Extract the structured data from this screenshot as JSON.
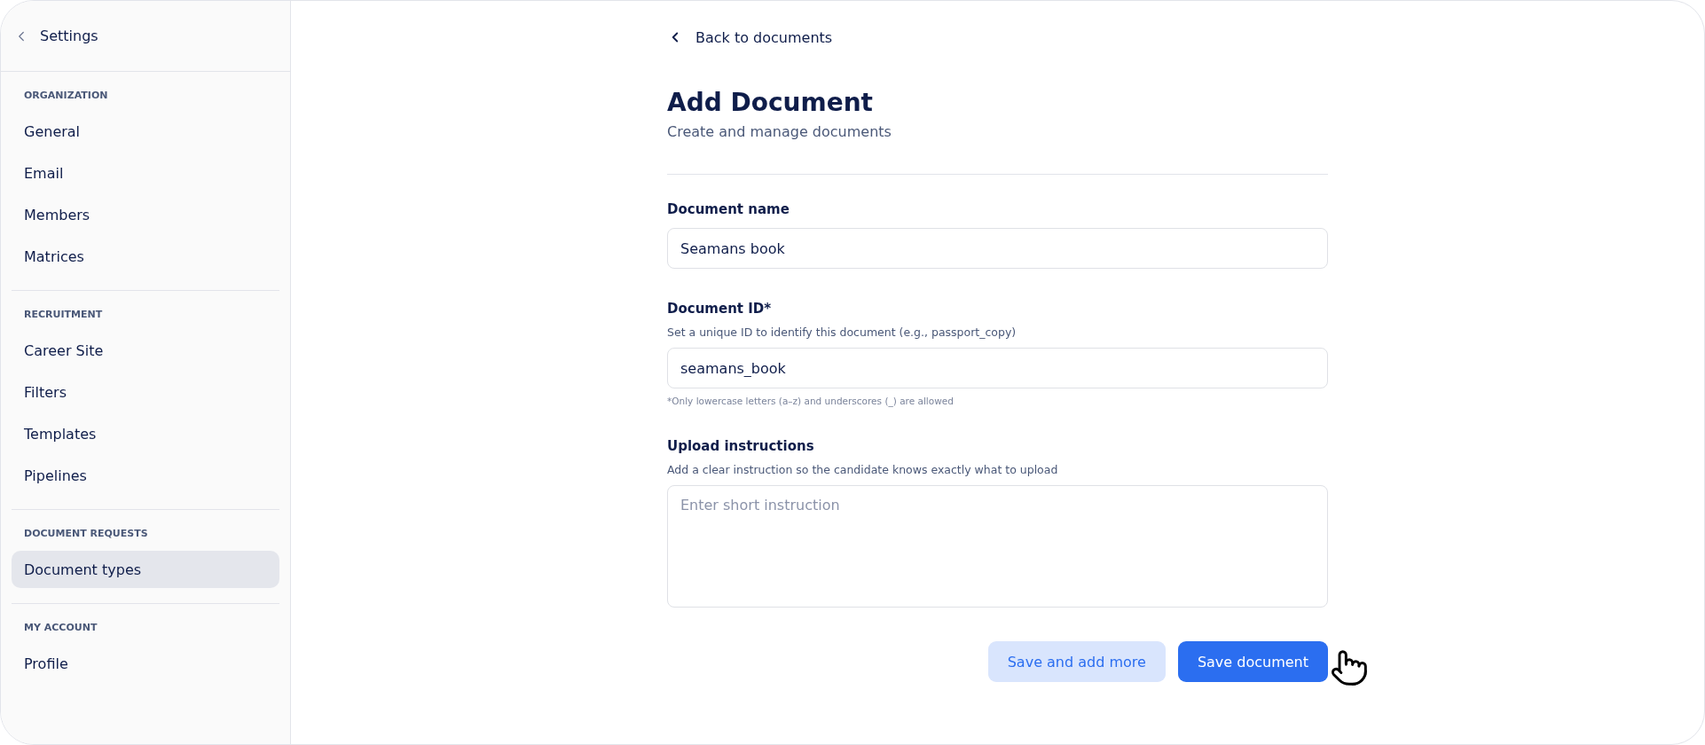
{
  "sidebar": {
    "back_label": "Settings",
    "sections": [
      {
        "title": "ORGANIZATION",
        "items": [
          {
            "label": "General",
            "selected": false
          },
          {
            "label": "Email",
            "selected": false
          },
          {
            "label": "Members",
            "selected": false
          },
          {
            "label": "Matrices",
            "selected": false
          }
        ]
      },
      {
        "title": "RECRUITMENT",
        "items": [
          {
            "label": "Career Site",
            "selected": false
          },
          {
            "label": "Filters",
            "selected": false
          },
          {
            "label": "Templates",
            "selected": false
          },
          {
            "label": "Pipelines",
            "selected": false
          }
        ]
      },
      {
        "title": "DOCUMENT REQUESTS",
        "items": [
          {
            "label": "Document types",
            "selected": true
          }
        ]
      },
      {
        "title": "MY ACCOUNT",
        "items": [
          {
            "label": "Profile",
            "selected": false
          }
        ]
      }
    ]
  },
  "main": {
    "back_link": "Back to documents",
    "title": "Add Document",
    "subtitle": "Create and manage documents",
    "fields": [
      {
        "kind": "input",
        "label": "Document name",
        "value": "Seamans book"
      },
      {
        "kind": "input",
        "label": "Document ID*",
        "help": "Set a unique ID to identify this document (e.g., passport_copy)",
        "value": "seamans_book",
        "note": "*Only lowercase letters (a–z) and underscores (_) are allowed"
      },
      {
        "kind": "textarea",
        "label": "Upload instructions",
        "help": "Add a clear instruction so the candidate knows exactly what to upload",
        "placeholder": "Enter short instruction"
      }
    ],
    "buttons": [
      {
        "kind": "secondary",
        "label": "Save and add more"
      },
      {
        "kind": "primary",
        "label": "Save document"
      }
    ]
  }
}
